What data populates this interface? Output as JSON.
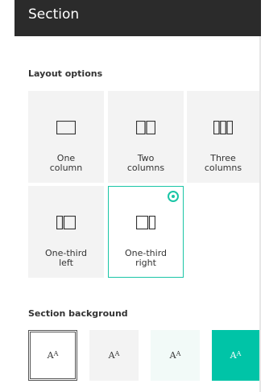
{
  "header": {
    "title": "Section"
  },
  "layout": {
    "label": "Layout options",
    "options": [
      {
        "line1": "One",
        "line2": "column",
        "icon": "one-column-icon",
        "selected": false
      },
      {
        "line1": "Two",
        "line2": "columns",
        "icon": "two-columns-icon",
        "selected": false
      },
      {
        "line1": "Three",
        "line2": "columns",
        "icon": "three-columns-icon",
        "selected": false
      },
      {
        "line1": "One-third",
        "line2": "left",
        "icon": "one-third-left-icon",
        "selected": false
      },
      {
        "line1": "One-third",
        "line2": "right",
        "icon": "one-third-right-icon",
        "selected": true
      }
    ]
  },
  "background": {
    "label": "Section background",
    "swatch_text": "AA",
    "swatches": [
      {
        "name": "none",
        "color": "#ffffff",
        "selected": true
      },
      {
        "name": "neutral",
        "color": "#f3f3f3",
        "selected": false
      },
      {
        "name": "soft",
        "color": "#f2faf8",
        "selected": false
      },
      {
        "name": "strong",
        "color": "#00c4a7",
        "selected": false
      }
    ]
  },
  "colors": {
    "accent": "#1ac5a6",
    "header_bg": "#2b2b2b"
  }
}
